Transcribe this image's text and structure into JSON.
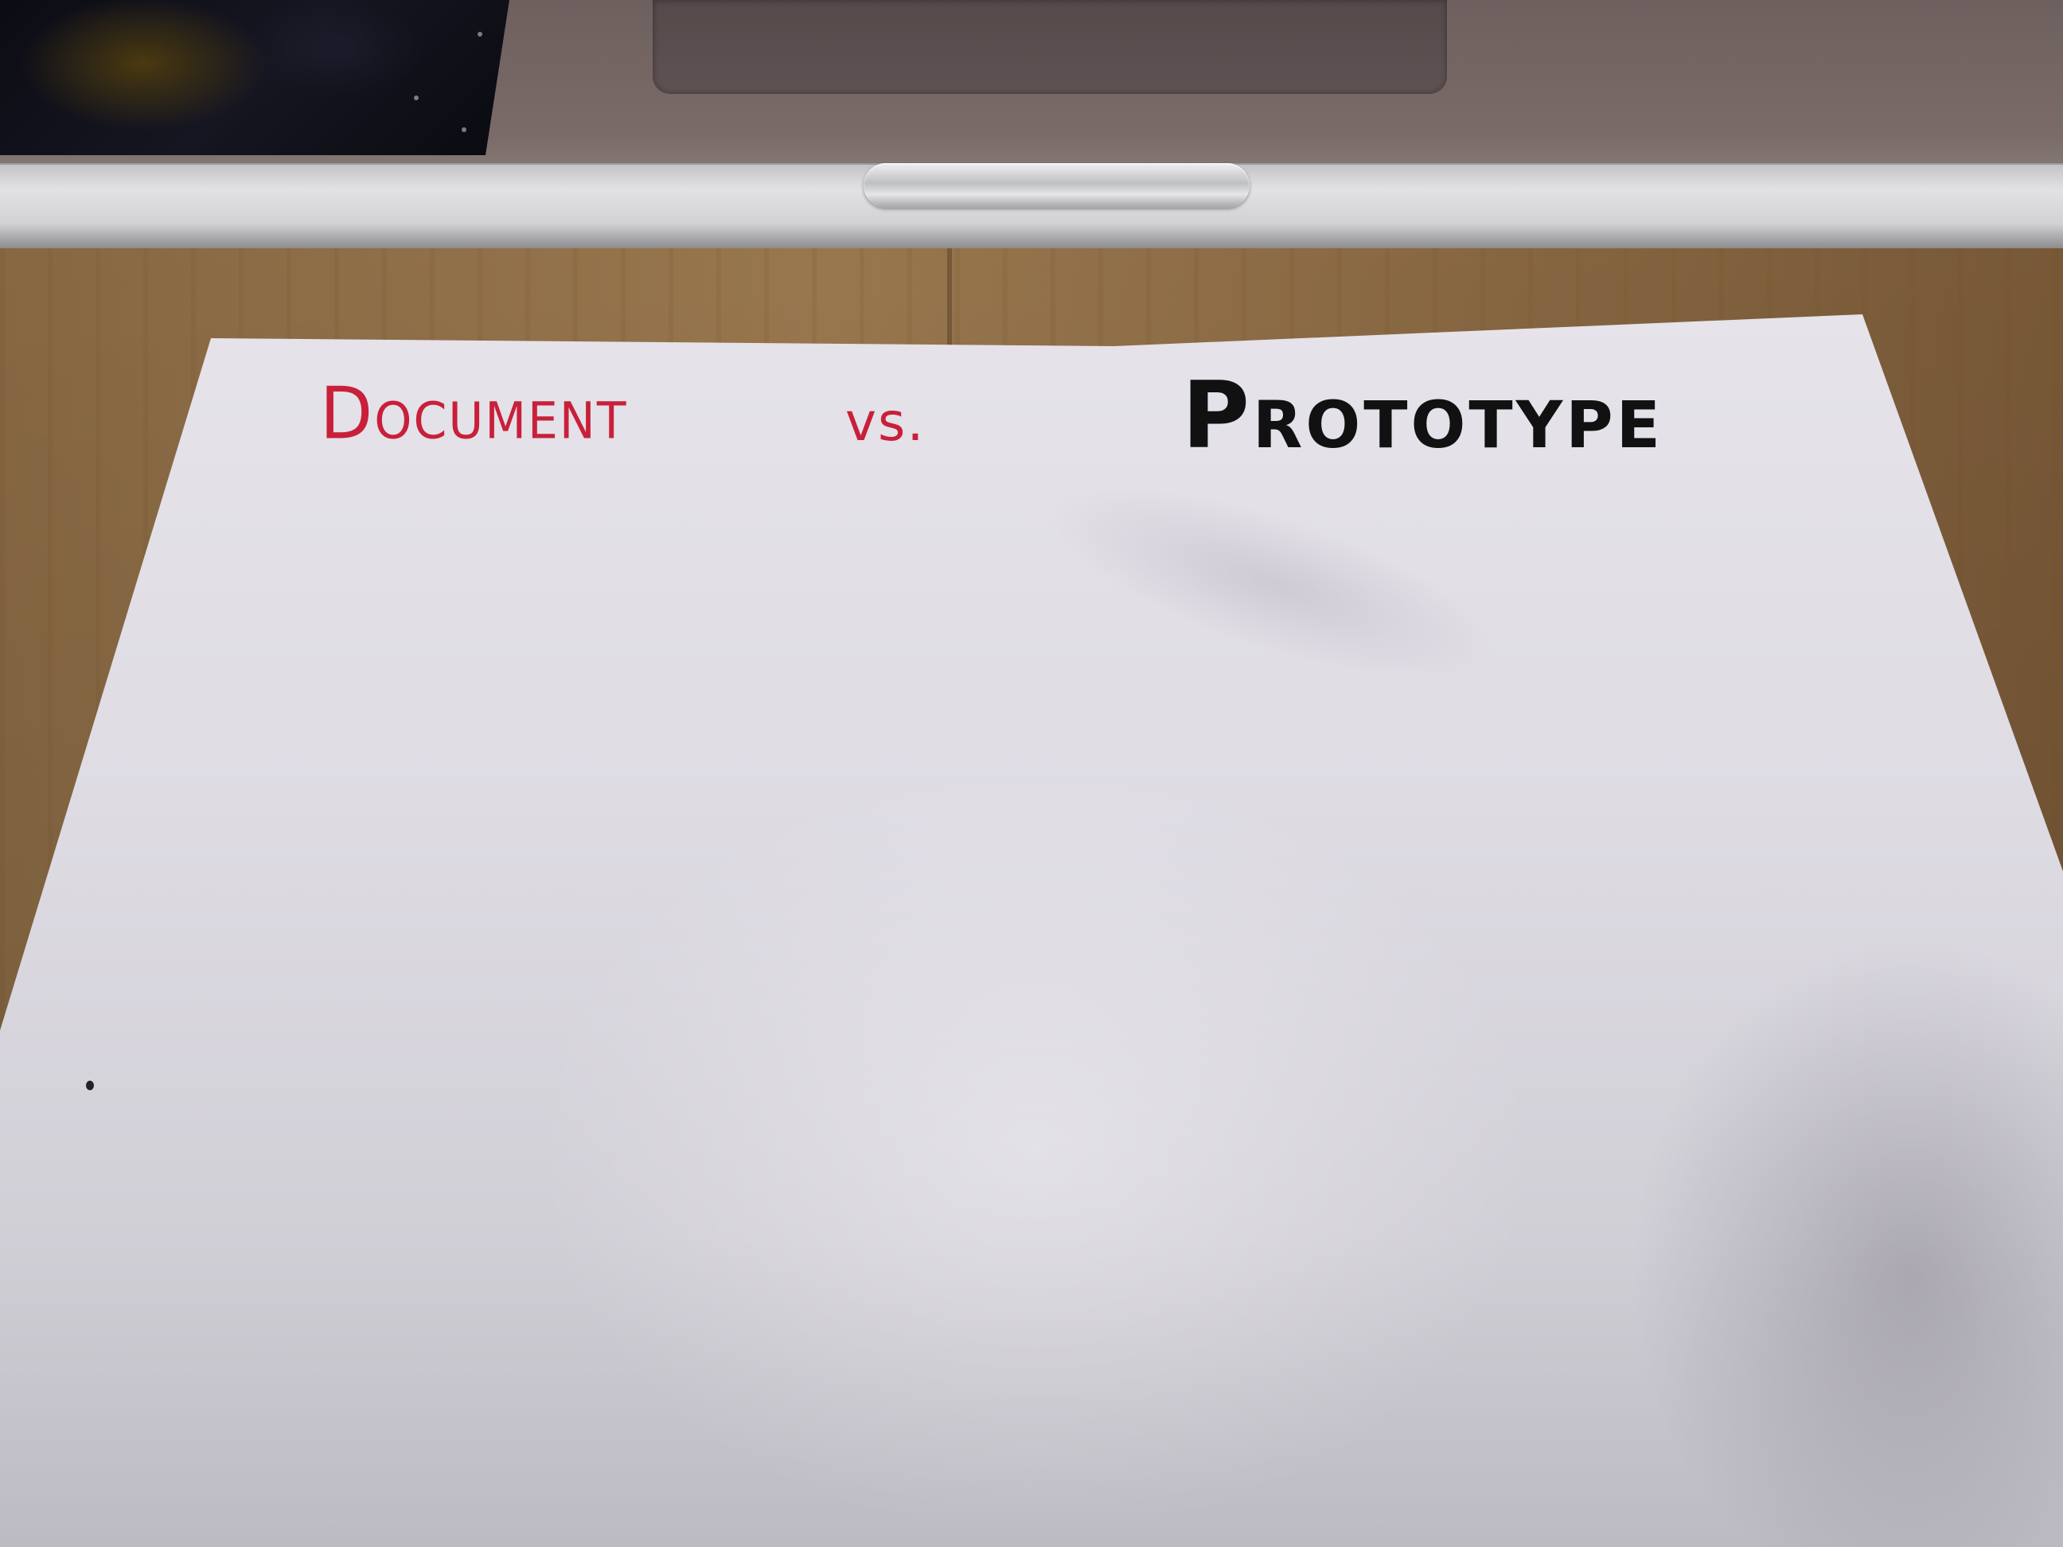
{
  "paper": {
    "left_heading": "Document",
    "middle_text": "vs.",
    "right_heading": "Prototype"
  },
  "colors": {
    "left_ink": "#c8203a",
    "middle_ink": "#c8203a",
    "right_ink": "#111111",
    "paper": "#e6e3ea",
    "desk": "#9c7a50",
    "laptop": "#d6d6d8"
  }
}
